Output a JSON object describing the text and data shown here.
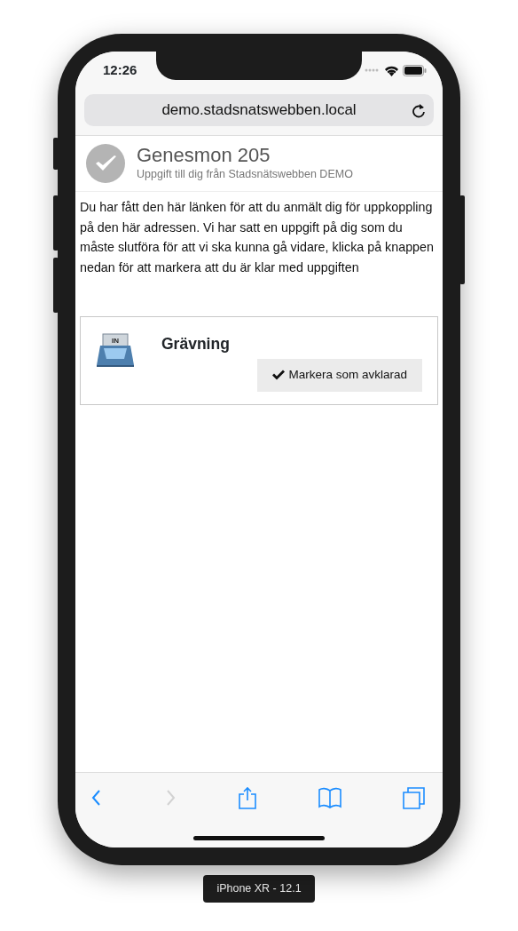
{
  "status_bar": {
    "time": "12:26"
  },
  "address_bar": {
    "url": "demo.stadsnatswebben.local"
  },
  "header": {
    "title": "Genesmon 205",
    "subtitle": "Uppgift till dig från Stadsnätswebben DEMO"
  },
  "intro": "Du har fått den här länken för att du anmält dig för uppkoppling på den här adressen. Vi har satt en uppgift på dig som du måste slutföra för att vi ska kunna gå vidare, klicka på knappen nedan för att markera att du är klar med uppgiften",
  "task": {
    "icon_label": "IN",
    "title": "Grävning",
    "button": "Markera som avklarad"
  },
  "toolbar": [
    {
      "kind": "back",
      "disabled": false
    },
    {
      "kind": "forward",
      "disabled": true
    },
    {
      "kind": "share",
      "disabled": false
    },
    {
      "kind": "bookmarks",
      "disabled": false
    },
    {
      "kind": "tabs",
      "disabled": false
    }
  ],
  "device_label": "iPhone XR - 12.1"
}
